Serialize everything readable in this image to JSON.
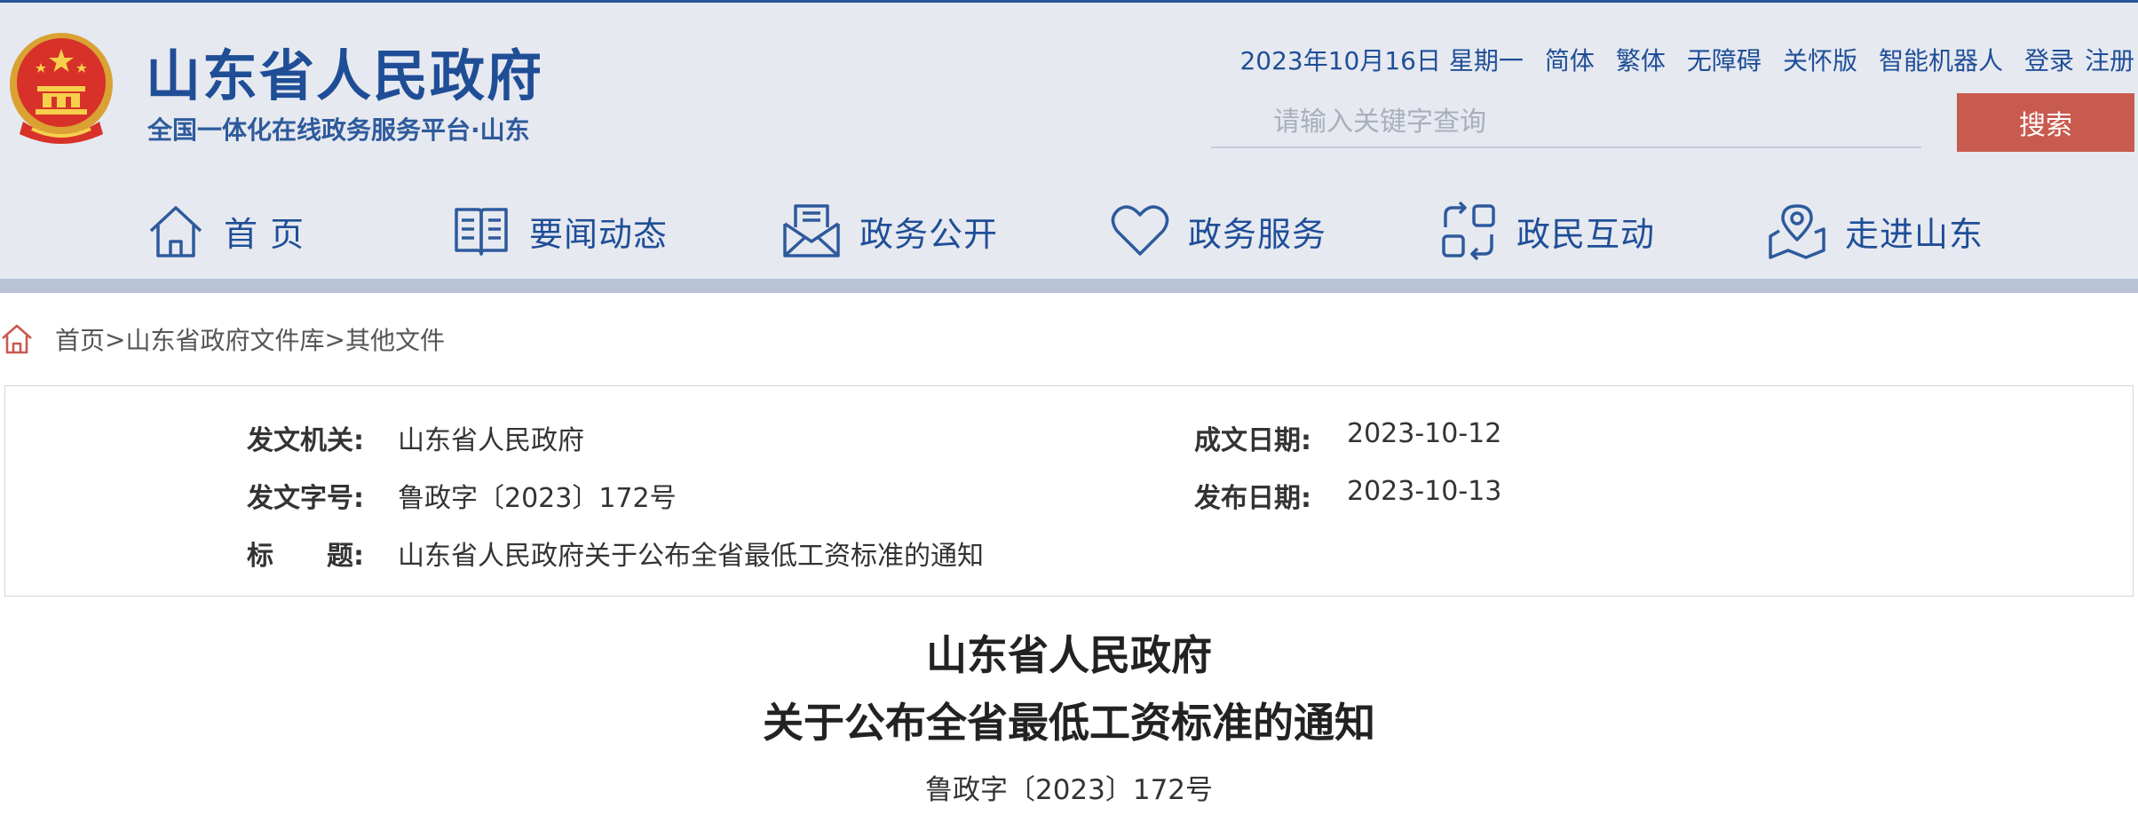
{
  "header": {
    "site_title": "山东省人民政府",
    "site_subtitle": "全国一体化在线政务服务平台·山东",
    "date": "2023年10月16日 星期一",
    "links": [
      "简体",
      "繁体",
      "无障碍",
      "关怀版",
      "智能机器人",
      "登录",
      "注册"
    ],
    "search": {
      "placeholder": "请输入关键字查询",
      "button_label": "搜索"
    },
    "colors": {
      "brand_blue": "#1f4e97",
      "search_red": "#c85a4e",
      "header_bg": "#e6e9f0"
    }
  },
  "nav": {
    "items": [
      {
        "label": "首 页",
        "icon": "house-icon"
      },
      {
        "label": "要闻动态",
        "icon": "book-icon"
      },
      {
        "label": "政务公开",
        "icon": "envelope-document-icon"
      },
      {
        "label": "政务服务",
        "icon": "heart-icon"
      },
      {
        "label": "政民互动",
        "icon": "exchange-icon"
      },
      {
        "label": "走进山东",
        "icon": "map-pin-icon"
      }
    ]
  },
  "breadcrumb": {
    "icon": "home-icon",
    "items": [
      "首页",
      "山东省政府文件库",
      "其他文件"
    ],
    "separator": ">"
  },
  "info": {
    "issuer_label": "发文机关:",
    "issuer_value": "山东省人民政府",
    "doc_no_label": "发文字号:",
    "doc_no_value": "鲁政字〔2023〕172号",
    "title_label": "标　　题:",
    "title_value": "山东省人民政府关于公布全省最低工资标准的通知",
    "written_date_label": "成文日期:",
    "written_date_value": "2023-10-12",
    "publish_date_label": "发布日期:",
    "publish_date_value": "2023-10-13"
  },
  "document": {
    "title_line1": "山东省人民政府",
    "title_line2": "关于公布全省最低工资标准的通知",
    "number": "鲁政字〔2023〕172号"
  }
}
